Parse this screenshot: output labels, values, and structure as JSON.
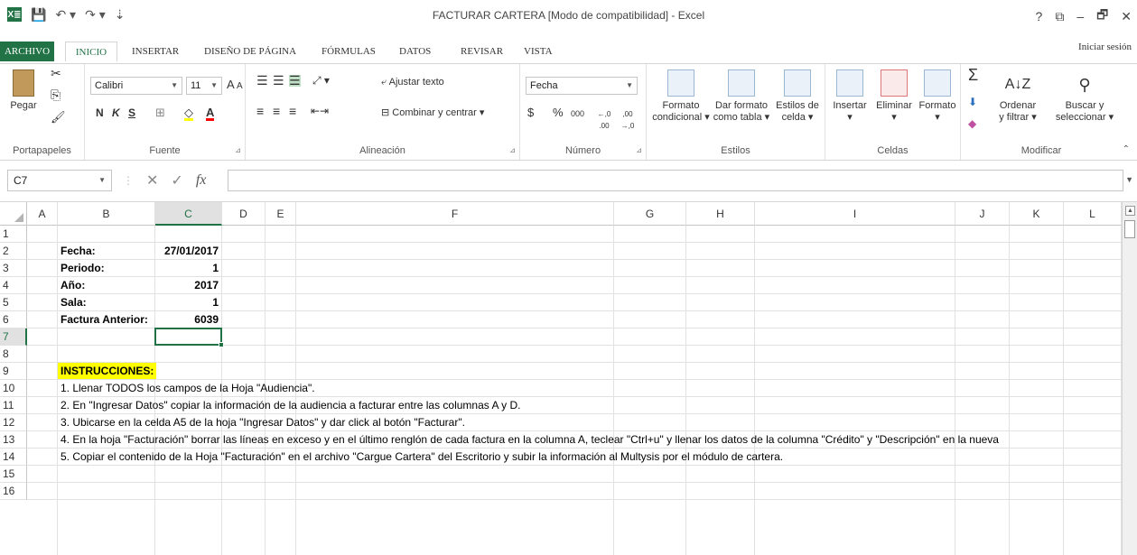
{
  "window": {
    "title": "FACTURAR CARTERA  [Modo de compatibilidad] - Excel",
    "help": "?",
    "restore": "⧉",
    "minimize": "–",
    "maximize": "🗗",
    "close": "✕",
    "sign_in": "Iniciar sesión"
  },
  "qat": {
    "app_logo": "X≣",
    "save": "💾",
    "undo": "↶ ▾",
    "redo": "↷ ▾",
    "customize": "⇣"
  },
  "tabs": [
    {
      "label": "ARCHIVO"
    },
    {
      "label": "INICIO"
    },
    {
      "label": "INSERTAR"
    },
    {
      "label": "DISEÑO DE PÁGINA"
    },
    {
      "label": "FÓRMULAS"
    },
    {
      "label": "DATOS"
    },
    {
      "label": "REVISAR"
    },
    {
      "label": "VISTA"
    }
  ],
  "ribbon": {
    "portapapeles": {
      "label": "Portapapeles",
      "paste": "Pegar",
      "cut": "✂",
      "copy": "⎘",
      "format_painter": "🖌"
    },
    "fuente": {
      "label": "Fuente",
      "font_name": "Calibri",
      "font_size": "11",
      "grow": "A",
      "shrink": "A",
      "bold": "N",
      "italic": "K",
      "underline": "S",
      "borders": "⊞",
      "fill": "◇",
      "font_color": "A"
    },
    "alineacion": {
      "label": "Alineación",
      "wrap": "Ajustar texto",
      "merge": "Combinar y centrar"
    },
    "numero": {
      "label": "Número",
      "format": "Fecha",
      "currency": "$",
      "percent": "%",
      "thousands": "000",
      "inc_dec": "←,0 .00",
      "dec_dec": ",00 →,0"
    },
    "estilos": {
      "label": "Estilos",
      "cond_format_1": "Formato",
      "cond_format_2": "condicional ▾",
      "table_format_1": "Dar formato",
      "table_format_2": "como tabla ▾",
      "cell_styles_1": "Estilos de",
      "cell_styles_2": "celda ▾"
    },
    "celdas": {
      "label": "Celdas",
      "insert": "Insertar",
      "delete": "Eliminar",
      "format": "Formato"
    },
    "modificar": {
      "label": "Modificar",
      "sum": "Σ",
      "sort_1": "Ordenar",
      "sort_2": "y filtrar ▾",
      "find_1": "Buscar y",
      "find_2": "seleccionar ▾"
    }
  },
  "formula_bar": {
    "name_box": "C7",
    "cancel": "✕",
    "enter": "✓",
    "fx": "fx",
    "value": ""
  },
  "sheet": {
    "columns": [
      "A",
      "B",
      "C",
      "D",
      "E",
      "F",
      "G",
      "H",
      "I",
      "J",
      "K",
      "L"
    ],
    "rows": [
      "1",
      "2",
      "3",
      "4",
      "5",
      "6",
      "7",
      "8",
      "9",
      "10",
      "11",
      "12",
      "13",
      "14",
      "15",
      "16"
    ],
    "selected_cell": "C7",
    "cells": {
      "B2": "Fecha:",
      "C2": "27/01/2017",
      "B3": "Periodo:",
      "C3": "1",
      "B4": "Año:",
      "C4": "2017",
      "B5": "Sala:",
      "C5": "1",
      "B6": "Factura Anterior:",
      "C6": "6039",
      "B9": "INSTRUCCIONES:",
      "B10": "1. Llenar TODOS los campos de la Hoja \"Audiencia\".",
      "B11": "2. En \"Ingresar Datos\" copiar la información de la audiencia a facturar entre las columnas A y D.",
      "B12": "3. Ubicarse en la celda A5 de la hoja \"Ingresar Datos\" y dar click al botón \"Facturar\".",
      "B13": "4. En la hoja \"Facturación\" borrar las líneas en exceso y en el último renglón de cada factura en la columna A, teclear \"Ctrl+u\" y llenar los datos de la columna \"Crédito\" y \"Descripción\" en la nueva",
      "B14": "5. Copiar el contenido de la Hoja \"Facturación\" en el archivo \"Cargue Cartera\" del Escritorio y subir la información al Multysis por el módulo de cartera."
    }
  }
}
